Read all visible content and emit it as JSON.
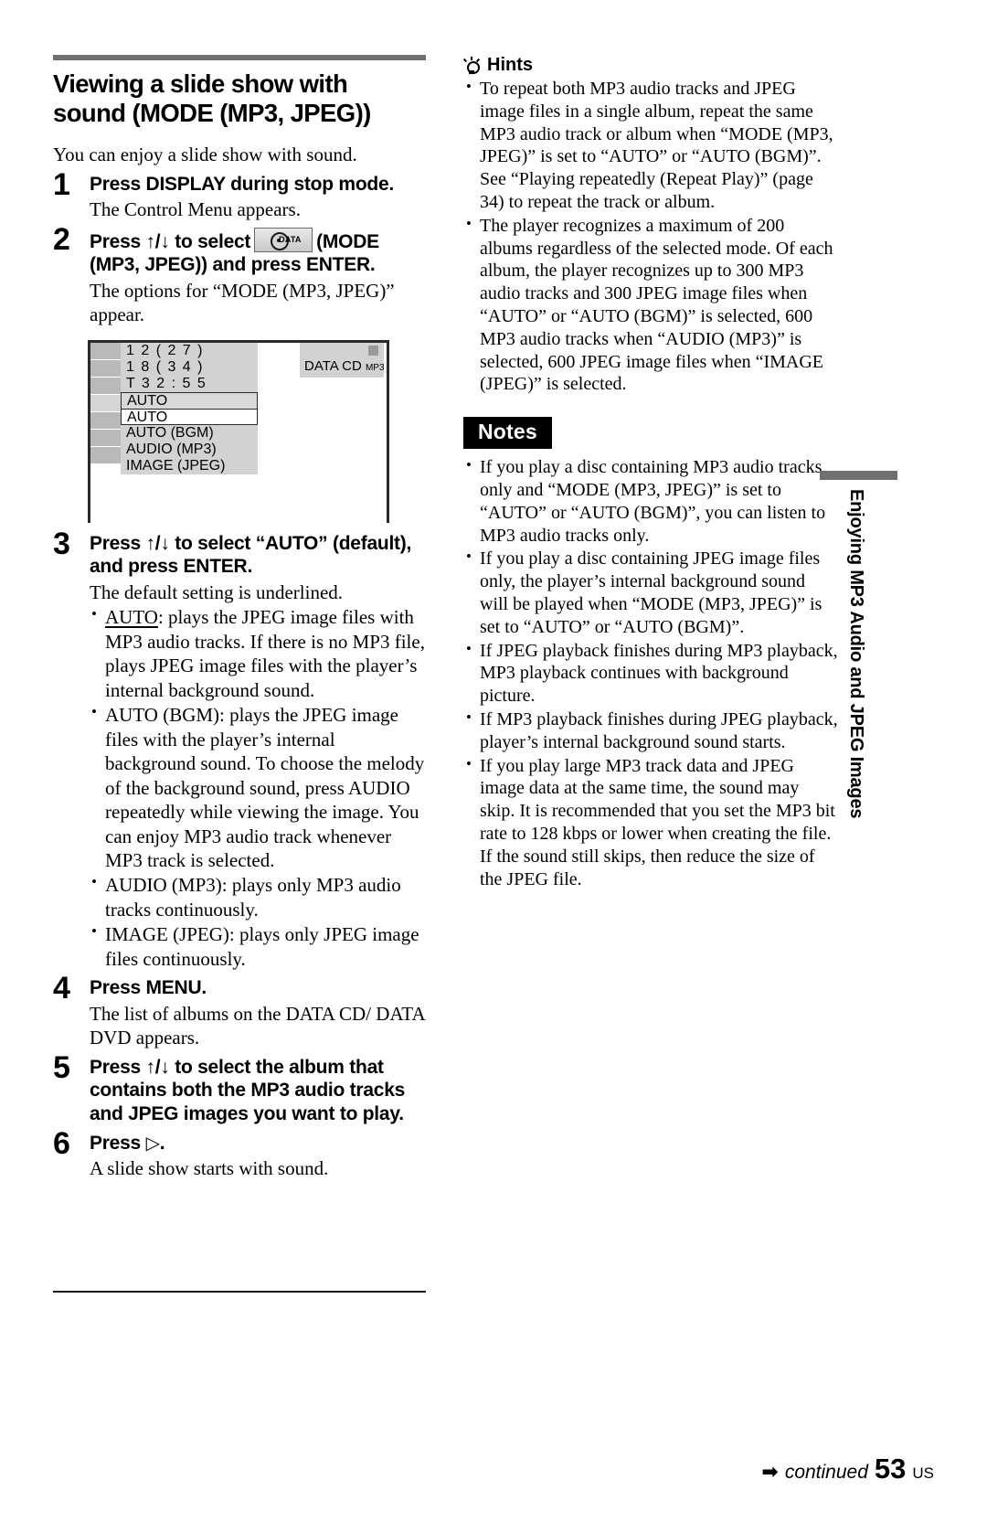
{
  "document": {
    "page_number": "53",
    "region_code": "US",
    "continued_label": "continued",
    "continued_arrow": "arrow-right-icon",
    "side_tab_text": "Enjoying MP3 Audio and JPEG Images"
  },
  "left_column": {
    "title": "Viewing a slide show with sound (MODE (MP3, JPEG))",
    "intro": "You can enjoy a slide show with sound.",
    "steps": [
      {
        "number": "1",
        "title": "Press DISPLAY during stop mode.",
        "body": "The Control Menu appears."
      },
      {
        "number": "2",
        "title_part1": "Press ↑/↓ to select",
        "icon": "data-cd-mode-icon",
        "icon_label": "DATA",
        "title_part2": "(MODE (MP3, JPEG)) and press ENTER.",
        "body": "The options for “MODE (MP3, JPEG)” appear."
      },
      {
        "number": "3",
        "title": "Press ↑/↓ to select “AUTO” (default), and press ENTER.",
        "body": "The default setting is underlined.",
        "bullets": [
          {
            "term": "AUTO",
            "underlined": true,
            "text": ": plays the JPEG image files with MP3 audio tracks. If there is no MP3 file, plays JPEG image files with the player’s internal background sound."
          },
          {
            "term": "AUTO (BGM)",
            "underlined": false,
            "text": ": plays the JPEG image files with the player’s internal background sound. To choose the melody of the background sound, press AUDIO repeatedly while viewing the image. You can enjoy MP3 audio track whenever MP3 track is selected."
          },
          {
            "term": "AUDIO (MP3)",
            "underlined": false,
            "text": ": plays only MP3 audio tracks continuously."
          },
          {
            "term": "IMAGE (JPEG)",
            "underlined": false,
            "text": ": plays only JPEG image files continuously."
          }
        ]
      },
      {
        "number": "4",
        "title": "Press MENU.",
        "body": "The list of albums on the DATA CD/ DATA DVD appears."
      },
      {
        "number": "5",
        "title": "Press ↑/↓ to select the album that contains both the MP3 audio tracks and JPEG images you want to play.",
        "body": ""
      },
      {
        "number": "6",
        "title_prefix": "Press",
        "title_glyph": "▷",
        "title_suffix": ".",
        "body": "A slide show starts with sound."
      }
    ],
    "osd_diagram": {
      "info_rows": [
        "1 2 ( 2 7 )",
        "1 8 ( 3 4 )",
        "T        3 2 : 5 5"
      ],
      "options": [
        "AUTO",
        "AUTO",
        "AUTO (BGM)",
        "AUDIO (MP3)",
        "IMAGE (JPEG)"
      ],
      "highlighted_option_index": 0,
      "selected_option_index": 1,
      "disc_label": "DATA CD",
      "disc_label_small": "MP3",
      "stop_indicator": "stop-square-icon"
    }
  },
  "right_column": {
    "hints": {
      "icon": "lightbulb-icon",
      "heading": "Hints",
      "items": [
        "To repeat both MP3 audio tracks and JPEG image files in a single album, repeat the same MP3 audio track or album when “MODE (MP3, JPEG)” is set to “AUTO” or “AUTO (BGM)”. See “Playing repeatedly (Repeat Play)” (page 34) to repeat the track or album.",
        "The player recognizes a maximum of 200 albums regardless of the selected mode. Of each album, the player recognizes up to 300 MP3 audio tracks and 300 JPEG image files when “AUTO” or “AUTO (BGM)” is selected, 600 MP3 audio tracks when “AUDIO (MP3)” is selected, 600 JPEG image files when “IMAGE (JPEG)” is selected."
      ]
    },
    "notes": {
      "heading": "Notes",
      "items": [
        "If you play a disc containing MP3 audio tracks only and “MODE (MP3, JPEG)” is set to “AUTO” or “AUTO (BGM)”, you can listen to MP3 audio tracks only.",
        "If you play a disc containing JPEG image files only, the player’s internal background sound will be played when “MODE (MP3, JPEG)” is set to “AUTO” or “AUTO (BGM)”.",
        "If JPEG playback finishes during MP3 playback, MP3 playback continues with background picture.",
        "If MP3 playback finishes during JPEG playback, player’s internal background sound starts.",
        "If you play large MP3 track data and JPEG image data at the same time, the sound may skip. It is recommended that you set the MP3 bit rate to 128 kbps or lower when creating the file. If the sound still skips, then reduce the size of the JPEG file."
      ]
    }
  },
  "colors": {
    "rule_gray": "#6f6f6f",
    "osd_panel": "#d2d2d2",
    "osd_icon_cell": "#b9b9b9",
    "notes_badge_bg": "#000000"
  }
}
